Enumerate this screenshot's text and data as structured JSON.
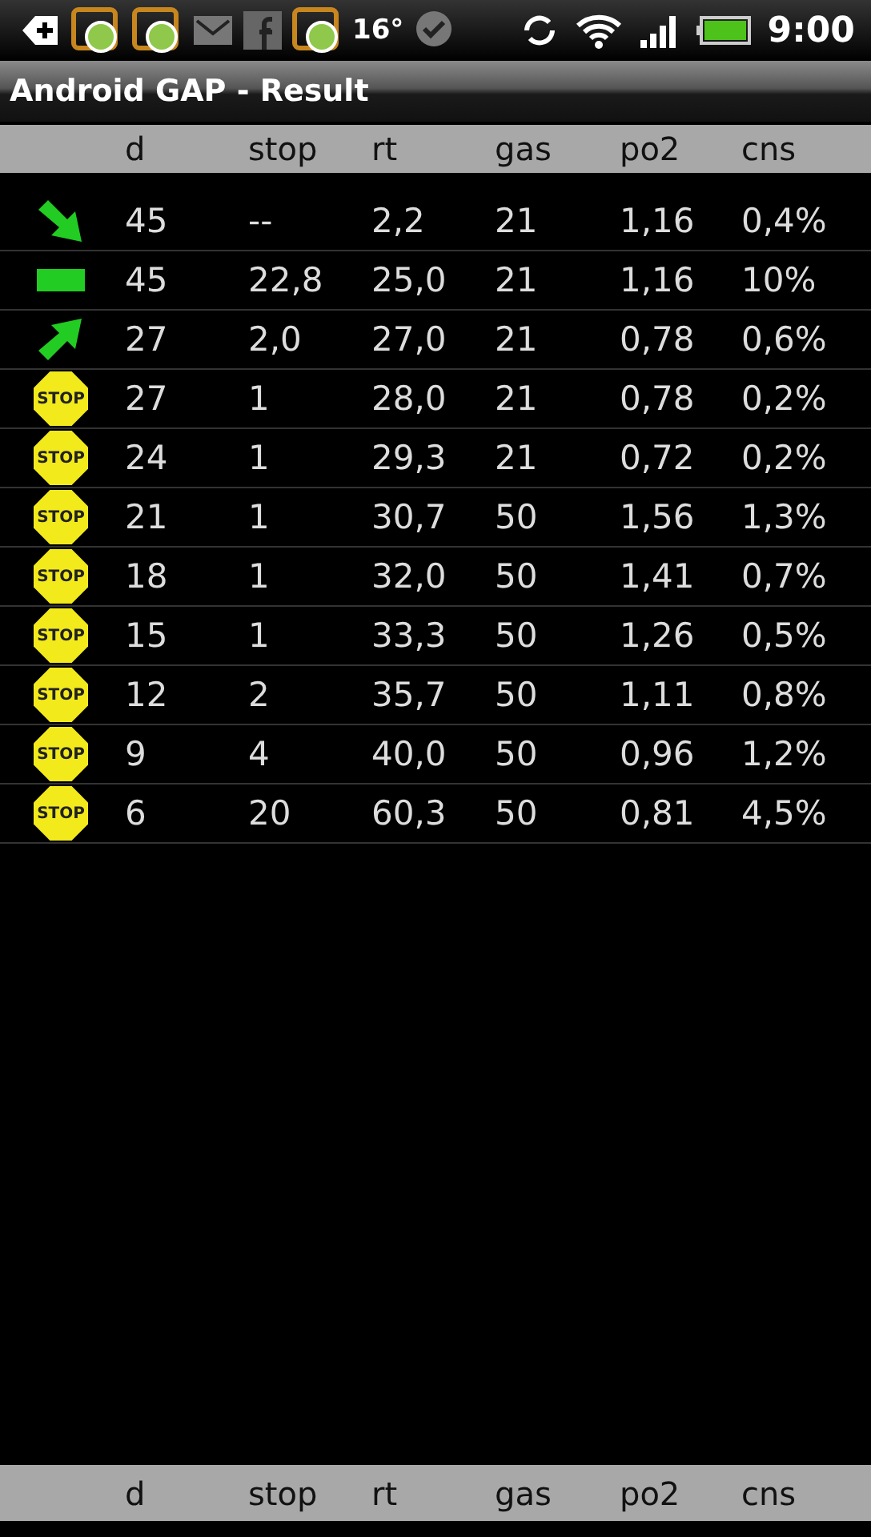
{
  "status_bar": {
    "temperature": "16°",
    "time": "9:00"
  },
  "window": {
    "title": "Android GAP - Result"
  },
  "table": {
    "columns": [
      "d",
      "stop",
      "rt",
      "gas",
      "po2",
      "cns"
    ],
    "rows": [
      {
        "kind": "descend",
        "cells": [
          "45",
          "--",
          "2,2",
          "21",
          "1,16",
          "0,4%"
        ]
      },
      {
        "kind": "level",
        "cells": [
          "45",
          "22,8",
          "25,0",
          "21",
          "1,16",
          "10%"
        ]
      },
      {
        "kind": "ascend",
        "cells": [
          "27",
          "2,0",
          "27,0",
          "21",
          "0,78",
          "0,6%"
        ]
      },
      {
        "kind": "stop",
        "sign": "STOP",
        "cells": [
          "27",
          "1",
          "28,0",
          "21",
          "0,78",
          "0,2%"
        ]
      },
      {
        "kind": "stop",
        "sign": "STOP",
        "cells": [
          "24",
          "1",
          "29,3",
          "21",
          "0,72",
          "0,2%"
        ]
      },
      {
        "kind": "stop",
        "sign": "STOP",
        "cells": [
          "21",
          "1",
          "30,7",
          "50",
          "1,56",
          "1,3%"
        ]
      },
      {
        "kind": "stop",
        "sign": "STOP",
        "cells": [
          "18",
          "1",
          "32,0",
          "50",
          "1,41",
          "0,7%"
        ]
      },
      {
        "kind": "stop",
        "sign": "STOP",
        "cells": [
          "15",
          "1",
          "33,3",
          "50",
          "1,26",
          "0,5%"
        ]
      },
      {
        "kind": "stop",
        "sign": "STOP",
        "cells": [
          "12",
          "2",
          "35,7",
          "50",
          "1,11",
          "0,8%"
        ]
      },
      {
        "kind": "stop",
        "sign": "STOP",
        "cells": [
          "9",
          "4",
          "40,0",
          "50",
          "0,96",
          "1,2%"
        ]
      },
      {
        "kind": "stop",
        "sign": "STOP",
        "cells": [
          "6",
          "20",
          "60,3",
          "50",
          "0,81",
          "4,5%"
        ]
      }
    ]
  },
  "footer": {
    "columns": [
      "d",
      "stop",
      "rt",
      "gas",
      "po2",
      "cns"
    ]
  }
}
